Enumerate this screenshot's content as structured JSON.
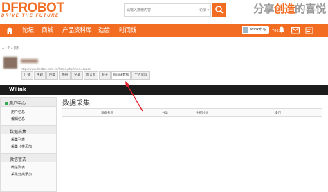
{
  "header": {
    "logo": "DFROBOT",
    "logo_tagline": "DRIVE THE FUTURE",
    "search_placeholder": "请输入搜索内容",
    "search_type": "论坛 ▾",
    "slogan_pre": "分享",
    "slogan_highlight": "创造",
    "slogan_post": "的喜悦"
  },
  "nav": {
    "items": [
      "论坛",
      "商城",
      "产品资料库",
      "造齿",
      "时间线"
    ],
    "user_chip": "Wink布马",
    "badge": "7663"
  },
  "breadcrumb": "⌂ › 个人资料",
  "profile_link": "http://www.dfrobot.com.cn/home.php?mod=space",
  "tabs": [
    "广播",
    "主题",
    "回复",
    "相册",
    "记录",
    "留言板",
    "帖子",
    "Wilink数据",
    "个人资料"
  ],
  "darkbar_title": "Wilink",
  "sidebar": {
    "sec1": "用户中心",
    "sec1_links": [
      "用户信息",
      "编辑信息"
    ],
    "sec2": "数据采集",
    "sec2_links": [
      "采集列表",
      "采集分类添加"
    ],
    "sec3": "微信管式",
    "sec3_links": [
      "微信列表",
      "采集分类添加"
    ]
  },
  "main": {
    "title": "数据采集",
    "columns": [
      "设备名称",
      "分类",
      "生成时间",
      "操作"
    ]
  },
  "colors": {
    "accent": "#f26c22",
    "dark": "#1c1c1c",
    "arrow": "#e0202a"
  }
}
